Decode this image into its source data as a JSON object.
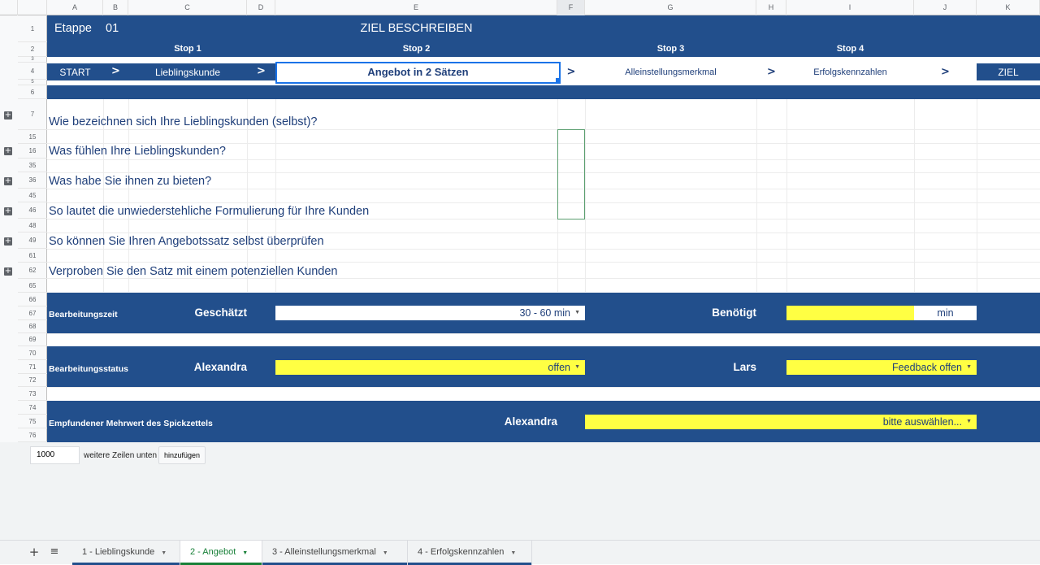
{
  "columns": [
    "A",
    "B",
    "C",
    "D",
    "E",
    "F",
    "G",
    "H",
    "I",
    "J",
    "K"
  ],
  "rows": [
    "1",
    "2",
    "3",
    "4",
    "5",
    "6",
    "7",
    "15",
    "16",
    "35",
    "36",
    "45",
    "46",
    "48",
    "49",
    "61",
    "62",
    "65",
    "66",
    "67",
    "68",
    "69",
    "70",
    "71",
    "72",
    "73",
    "74",
    "75",
    "76"
  ],
  "header": {
    "etappe_label": "Etappe",
    "etappe_number": "01",
    "title": "ZIEL BESCHREIBEN",
    "stops": [
      "Stop 1",
      "Stop 2",
      "Stop 3",
      "Stop 4"
    ]
  },
  "nav": {
    "start": "START",
    "arrow": ">",
    "step1": "Lieblingskunde",
    "step2": "Angebot in 2 Sätzen",
    "step3": "Alleinstellungsmerkmal",
    "step4": "Erfolgskennzahlen",
    "goal": "ZIEL"
  },
  "questions": [
    "Wie bezeichnen sich Ihre Lieblingskunden (selbst)?",
    "Was fühlen Ihre Lieblingskunden?",
    "Was habe Sie ihnen zu bieten?",
    "So lautet die unwiederstehliche Formulierung für Ihre Kunden",
    "So können Sie Ihren Angebotssatz selbst überprüfen",
    "Verproben Sie den Satz mit einem potenziellen Kunden"
  ],
  "time": {
    "label": "Bearbeitungszeit",
    "estimated_label": "Geschätzt",
    "estimated_value": "30 - 60 min",
    "needed_label": "Benötigt",
    "needed_value": "",
    "unit": "min"
  },
  "status": {
    "label": "Bearbeitungsstatus",
    "person1": "Alexandra",
    "person1_value": "offen",
    "person2": "Lars",
    "person2_value": "Feedback offen"
  },
  "value": {
    "label": "Empfundener Mehrwert des Spickzettels",
    "person": "Alexandra",
    "select_value": "bitte auswählen..."
  },
  "add_rows": {
    "count": "1000",
    "label": "weitere Zeilen unten",
    "button": "hinzufügen"
  },
  "tabs": [
    {
      "label": "1 - Lieblingskunde"
    },
    {
      "label": "2 - Angebot"
    },
    {
      "label": "3 - Alleinstellungsmerkmal"
    },
    {
      "label": "4 - Erfolgskennzahlen"
    }
  ],
  "colors": {
    "band": "#224f8c",
    "highlight": "#ffff43",
    "active_tab": "#188038"
  }
}
